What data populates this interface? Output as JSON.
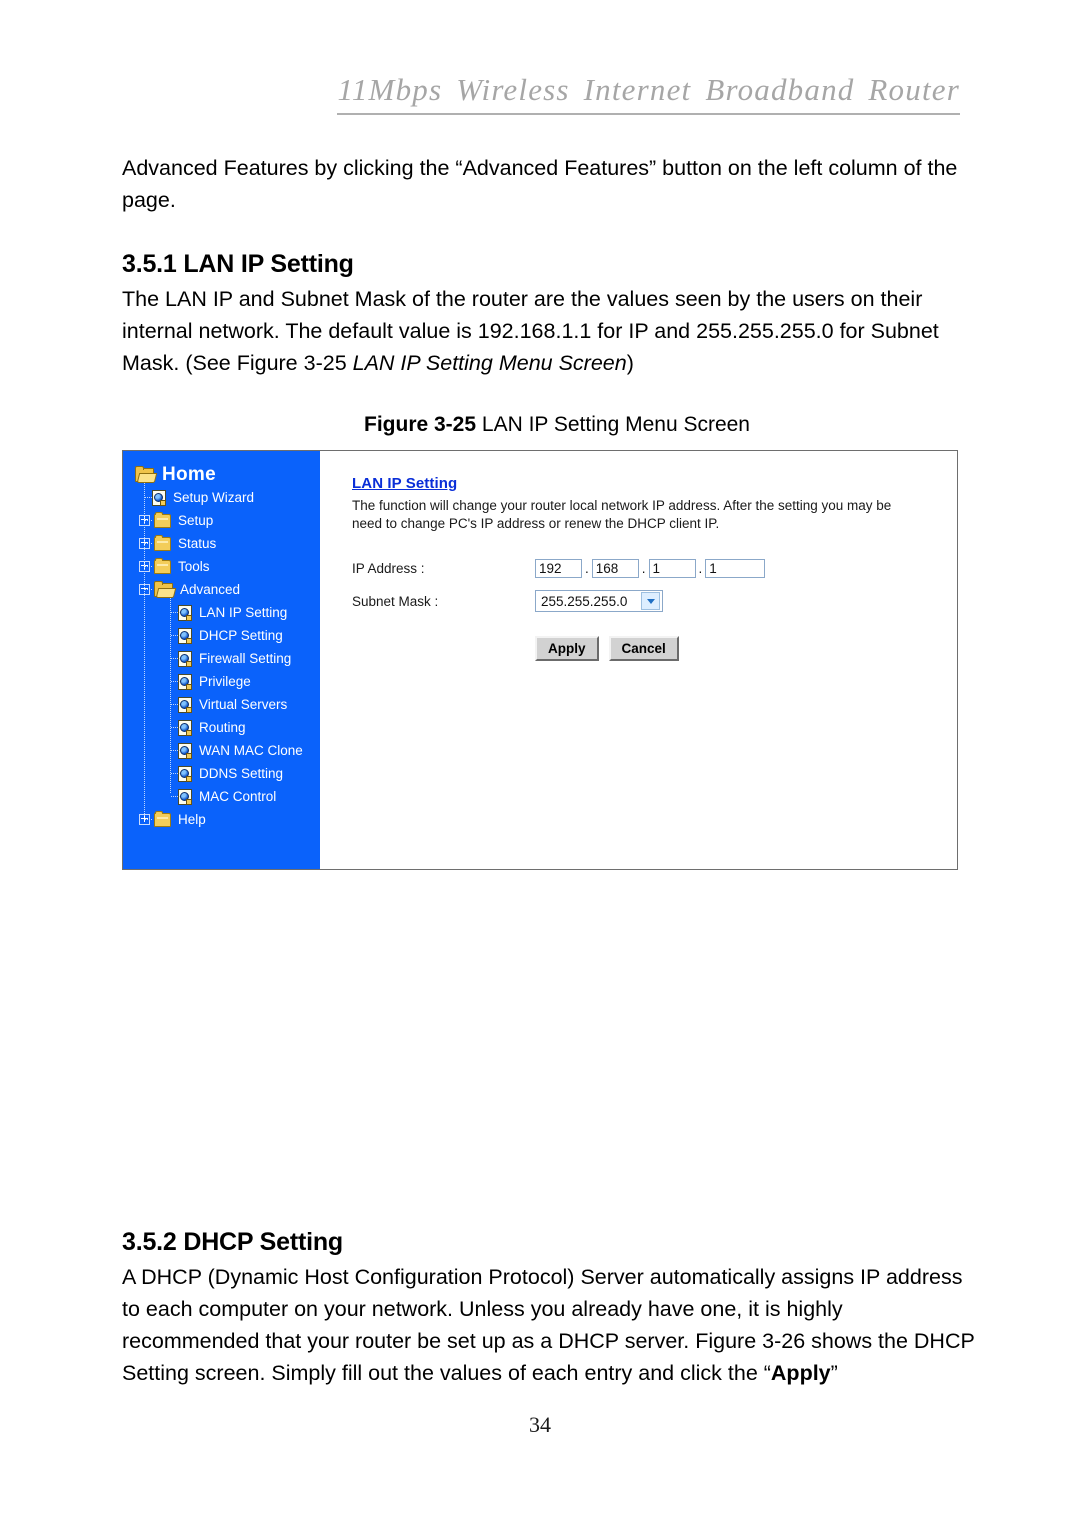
{
  "header": {
    "title": "11Mbps  Wireless  Internet  Broadband  Router"
  },
  "paragraphs": {
    "intro": "Advanced Features by clicking the “Advanced Features” button on the left column of the page."
  },
  "sections": [
    {
      "heading": "3.5.1 LAN IP Setting",
      "body_part1": "The LAN IP and Subnet Mask of the router are the values seen by the users on their internal network. The default value is 192.168.1.1 for IP and 255.255.255.0 for Subnet Mask. (See Figure 3-25 ",
      "body_italic": "LAN IP Setting Menu Screen",
      "body_part2": ")"
    },
    {
      "heading": "3.5.2 DHCP Setting",
      "body_part1": "A DHCP (Dynamic Host Configuration Protocol) Server automatically assigns IP address to each computer on your network. Unless you already have one, it is highly recommended that your router be set up as a DHCP server. Figure 3-26 shows the DHCP Setting screen. Simply fill out the values of each entry and click the “",
      "body_bold": "Apply",
      "body_part2": "”"
    }
  ],
  "figure": {
    "caption_label": "Figure 3-25",
    "caption_text": "LAN IP Setting Menu Screen",
    "sidebar": {
      "root": {
        "label": "Home",
        "icon": "open-folder-icon"
      },
      "items": [
        {
          "label": "Setup Wizard",
          "icon": "page-globe-icon",
          "level": 1,
          "expander": "none"
        },
        {
          "label": "Setup",
          "icon": "folder-icon",
          "level": 1,
          "expander": "plus"
        },
        {
          "label": "Status",
          "icon": "folder-icon",
          "level": 1,
          "expander": "plus"
        },
        {
          "label": "Tools",
          "icon": "folder-icon",
          "level": 1,
          "expander": "plus"
        },
        {
          "label": "Advanced",
          "icon": "open-folder-icon",
          "level": 1,
          "expander": "minus"
        },
        {
          "label": "LAN IP Setting",
          "icon": "page-globe-icon",
          "level": 2,
          "expander": "none"
        },
        {
          "label": "DHCP Setting",
          "icon": "page-globe-icon",
          "level": 2,
          "expander": "none"
        },
        {
          "label": "Firewall Setting",
          "icon": "page-globe-icon",
          "level": 2,
          "expander": "none"
        },
        {
          "label": "Privilege",
          "icon": "page-globe-icon",
          "level": 2,
          "expander": "none"
        },
        {
          "label": "Virtual Servers",
          "icon": "page-globe-icon",
          "level": 2,
          "expander": "none"
        },
        {
          "label": "Routing",
          "icon": "page-globe-icon",
          "level": 2,
          "expander": "none"
        },
        {
          "label": "WAN MAC Clone",
          "icon": "page-globe-icon",
          "level": 2,
          "expander": "none"
        },
        {
          "label": "DDNS Setting",
          "icon": "page-globe-icon",
          "level": 2,
          "expander": "none"
        },
        {
          "label": "MAC Control",
          "icon": "page-globe-icon",
          "level": 2,
          "expander": "none"
        },
        {
          "label": "Help",
          "icon": "folder-icon",
          "level": 1,
          "expander": "plus"
        }
      ]
    },
    "panel": {
      "title": "LAN IP Setting",
      "description": "The function will change your router local network IP address. After the setting you may be need to change PC's IP address or renew the DHCP client IP.",
      "ip_address_label": "IP Address :",
      "ip_octets": [
        "192",
        "168",
        "1",
        "1"
      ],
      "subnet_mask_label": "Subnet Mask :",
      "subnet_mask_value": "255.255.255.0",
      "apply_label": "Apply",
      "cancel_label": "Cancel"
    },
    "colors": {
      "sidebar_bg": "#0a62fb",
      "panel_title": "#0a2ed8",
      "header_gray": "#a6a6a6"
    }
  },
  "page_number": "34"
}
